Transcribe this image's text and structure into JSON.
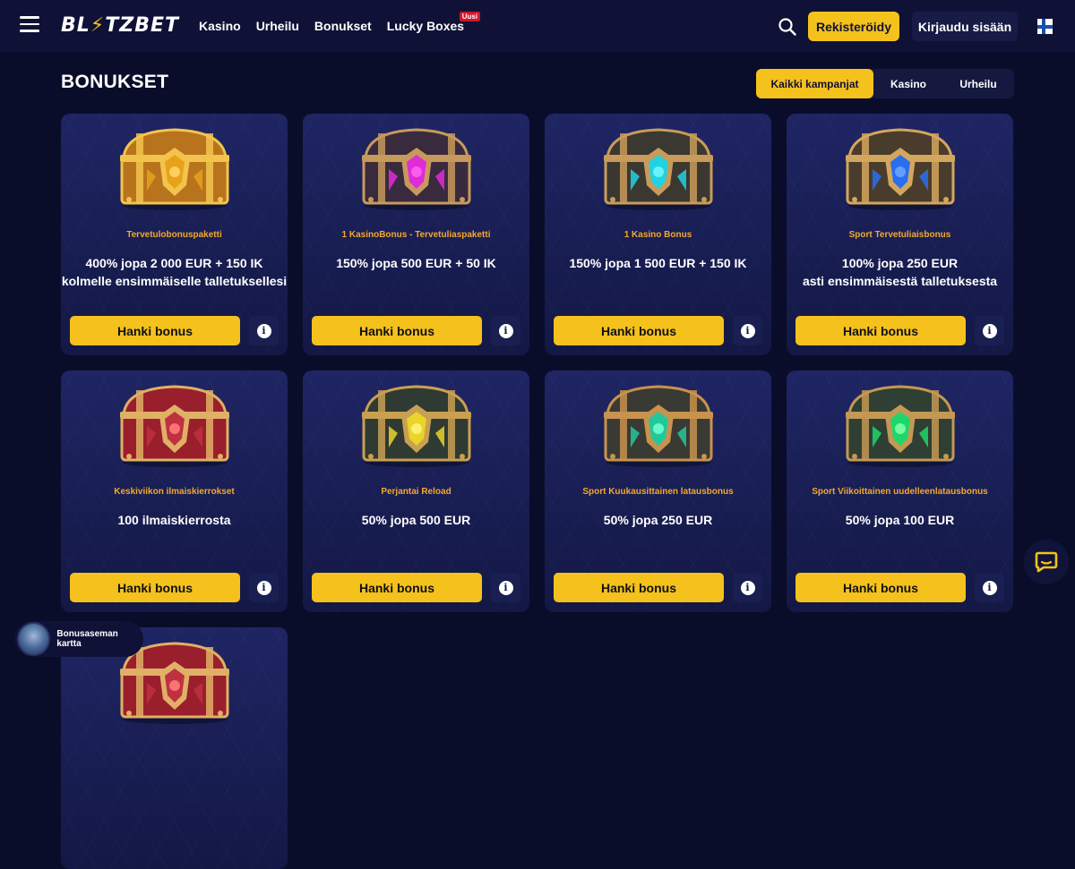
{
  "header": {
    "logo": "BLITZBET",
    "nav": [
      {
        "label": "Kasino"
      },
      {
        "label": "Urheilu"
      },
      {
        "label": "Bonukset"
      },
      {
        "label": "Lucky Boxes",
        "badge": "Uusi"
      }
    ],
    "register_label": "Rekisteröidy",
    "login_label": "Kirjaudu sisään",
    "icons": [
      "hamburger-icon",
      "search-icon",
      "finland-flag-icon"
    ]
  },
  "page": {
    "title": "BONUKSET",
    "filters": [
      "Kaikki kampanjat",
      "Kasino",
      "Urheilu"
    ],
    "active_filter": "Kaikki kampanjat"
  },
  "cards": [
    {
      "subtitle": "Tervetulobonuspaketti",
      "line1": "400% jopa 2 000 EUR + 150 IK",
      "line2": "kolmelle ensimmäiselle talletuksellesi",
      "button": "Hanki bonus",
      "chest": "gold-chest"
    },
    {
      "subtitle": "1 KasinoBonus - Tervetuliaspaketti",
      "line1": "150% jopa 500 EUR + 50 IK",
      "line2": "",
      "button": "Hanki bonus",
      "chest": "magenta-chest"
    },
    {
      "subtitle": "1 Kasino Bonus",
      "line1": "150% jopa 1 500 EUR + 150 IK",
      "line2": "",
      "button": "Hanki bonus",
      "chest": "cyan-chest"
    },
    {
      "subtitle": "Sport Tervetuliaisbonus",
      "line1": "100% jopa 250 EUR",
      "line2": "asti ensimmäisestä talletuksesta",
      "button": "Hanki bonus",
      "chest": "blue-chest"
    },
    {
      "subtitle": "Keskiviikon ilmaiskierrokset",
      "line1": "100 ilmaiskierrosta",
      "line2": "",
      "button": "Hanki bonus",
      "chest": "red-chest"
    },
    {
      "subtitle": "Perjantai Reload",
      "line1": "50% jopa 500 EUR",
      "line2": "",
      "button": "Hanki bonus",
      "chest": "yellow-chest"
    },
    {
      "subtitle": "Sport Kuukausittainen latausbonus",
      "line1": "50% jopa 250 EUR",
      "line2": "",
      "button": "Hanki bonus",
      "chest": "teal-chest"
    },
    {
      "subtitle": "Sport Viikoittainen uudelleenlatausbonus",
      "line1": "50% jopa 100 EUR",
      "line2": "",
      "button": "Hanki bonus",
      "chest": "green-chest"
    },
    {
      "subtitle": "",
      "line1": "",
      "line2": "",
      "button": "",
      "chest": "red-chest"
    }
  ],
  "floating": {
    "map_label": "Bonusaseman kartta",
    "chat_icon": "chat-icon"
  },
  "colors": {
    "background": "#0a0d2a",
    "header": "#0f1236",
    "accent": "#f4c11d",
    "subtitle": "#f4a92a"
  }
}
